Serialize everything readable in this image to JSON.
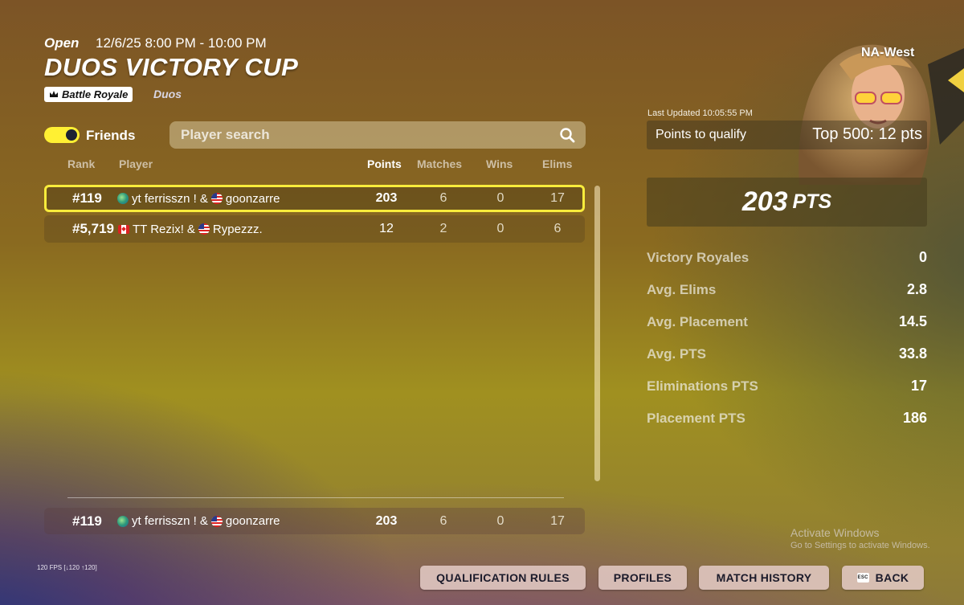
{
  "header": {
    "status": "Open",
    "date_range": "12/6/25 8:00 PM - 10:00 PM",
    "title": "DUOS VICTORY CUP",
    "mode": "Battle Royale",
    "team_type": "Duos"
  },
  "filters": {
    "friends_label": "Friends",
    "friends_on": true,
    "search_placeholder": "Player search"
  },
  "table": {
    "headers": {
      "rank": "Rank",
      "player": "Player",
      "points": "Points",
      "matches": "Matches",
      "wins": "Wins",
      "elims": "Elims"
    },
    "rows": [
      {
        "rank": "#119",
        "p1": "yt ferrisszn !",
        "sep": "&",
        "p2": "goonzarre",
        "points": "203",
        "matches": "6",
        "wins": "0",
        "elims": "17",
        "p1_flag": "globe-icon",
        "p2_flag": "us-flag-icon"
      },
      {
        "rank": "#5,719",
        "p1": "TT Rezix!",
        "sep": "&",
        "p2": "Rypezzz.",
        "points": "12",
        "matches": "2",
        "wins": "0",
        "elims": "6",
        "p1_flag": "canada-flag-icon",
        "p2_flag": "us-flag-icon"
      }
    ],
    "my_row": {
      "rank": "#119",
      "p1": "yt ferrisszn !",
      "sep": "&",
      "p2": "goonzarre",
      "points": "203",
      "matches": "6",
      "wins": "0",
      "elims": "17"
    }
  },
  "side": {
    "region": "NA-West",
    "last_updated": "Last Updated 10:05:55 PM",
    "qualify_label": "Points to qualify",
    "qualify_value": "Top 500: 12 pts",
    "total_points": "203",
    "total_unit": "PTS",
    "stats": [
      {
        "label": "Victory Royales",
        "value": "0"
      },
      {
        "label": "Avg. Elims",
        "value": "2.8"
      },
      {
        "label": "Avg. Placement",
        "value": "14.5"
      },
      {
        "label": "Avg. PTS",
        "value": "33.8"
      },
      {
        "label": "Eliminations PTS",
        "value": "17"
      },
      {
        "label": "Placement PTS",
        "value": "186"
      }
    ]
  },
  "watermark": {
    "line1": "Activate Windows",
    "line2": "Go to Settings to activate Windows."
  },
  "fps": "120 FPS [↓120 ↑120]",
  "buttons": {
    "rules": "QUALIFICATION RULES",
    "profiles": "PROFILES",
    "history": "MATCH HISTORY",
    "esc_key": "ESC",
    "back": "BACK"
  },
  "colors": {
    "highlight": "#f8ec3c",
    "toggle": "#fff033"
  }
}
